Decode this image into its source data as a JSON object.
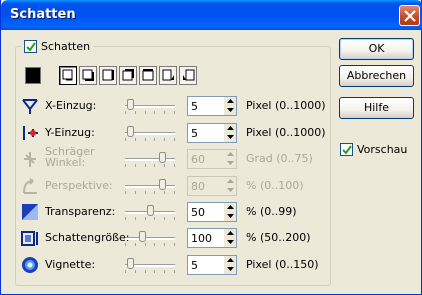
{
  "window": {
    "title": "Schatten"
  },
  "shadow_group": {
    "label": "Schatten",
    "checked": true
  },
  "color": "#000000",
  "presets": [
    "shadow-none",
    "shadow-bottom-right",
    "shadow-right",
    "shadow-top-right",
    "shadow-top",
    "shadow-perspective-right",
    "shadow-perspective-left"
  ],
  "rows": [
    {
      "label": "X-Einzug:",
      "value": "5",
      "unit": "Pixel (0..1000)",
      "enabled": true,
      "level": 0.05,
      "icon": "x-offset-icon"
    },
    {
      "label": "Y-Einzug:",
      "value": "5",
      "unit": "Pixel (0..1000)",
      "enabled": true,
      "level": 0.05,
      "icon": "y-offset-icon"
    },
    {
      "label": "Schräger\nWinkel:",
      "value": "60",
      "unit": "Grad (0..75)",
      "enabled": false,
      "level": 0.8,
      "icon": "skew-angle-icon"
    },
    {
      "label": "Perspektive:",
      "value": "80",
      "unit": "% (0..100)",
      "enabled": false,
      "level": 0.8,
      "icon": "perspective-icon"
    },
    {
      "label": "Transparenz:",
      "value": "50",
      "unit": "% (0..99)",
      "enabled": true,
      "level": 0.5,
      "icon": "transparency-icon"
    },
    {
      "label": "Schattengröße:",
      "value": "100",
      "unit": "% (50..200)",
      "enabled": true,
      "level": 0.33,
      "icon": "shadow-size-icon"
    },
    {
      "label": "Vignette:",
      "value": "5",
      "unit": "Pixel (0..150)",
      "enabled": true,
      "level": 0.05,
      "icon": "vignette-icon"
    }
  ],
  "buttons": {
    "ok": "OK",
    "cancel": "Abbrechen",
    "help": "Hilfe"
  },
  "preview": {
    "label": "Vorschau",
    "checked": true
  }
}
